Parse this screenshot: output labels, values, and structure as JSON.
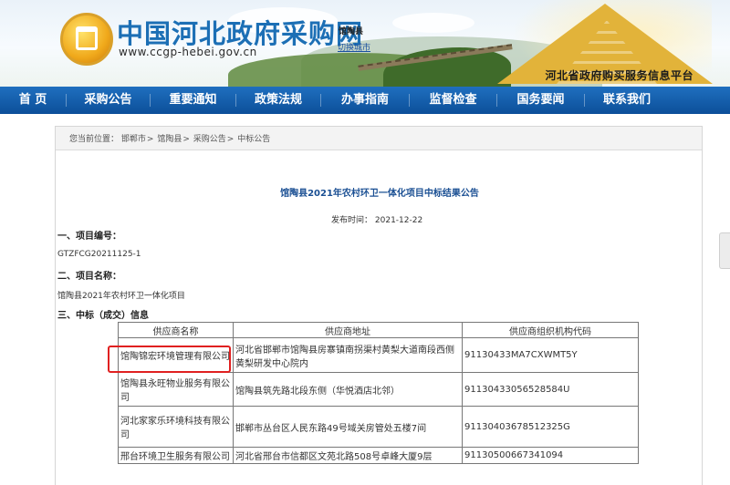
{
  "header": {
    "site_title": "中国河北政府采购网",
    "site_url": "www.ccgp-hebei.gov.cn",
    "city": "馆陶县",
    "switch_city": "切换城市",
    "platform": "河北省政府购买服务信息平台"
  },
  "nav": {
    "items": [
      {
        "label": "首  页"
      },
      {
        "label": "采购公告"
      },
      {
        "label": "重要通知"
      },
      {
        "label": "政策法规"
      },
      {
        "label": "办事指南"
      },
      {
        "label": "监督检查"
      },
      {
        "label": "国务要闻"
      },
      {
        "label": "联系我们"
      }
    ]
  },
  "breadcrumb": {
    "prefix": "您当前位置：",
    "items": [
      "邯郸市",
      "馆陶县",
      "采购公告",
      "中标公告"
    ],
    "separator": ">"
  },
  "notice": {
    "title": "馆陶县2021年农村环卫一体化项目中标结果公告",
    "publish_label": "发布时间：",
    "publish_date": "2021-12-22",
    "section1_title": "一、项目编号：",
    "section1_value": "GTZFCG20211125-1",
    "section2_title": "二、项目名称：",
    "section2_value": "馆陶县2021年农村环卫一体化项目",
    "section3_title": "三、中标（成交）信息"
  },
  "table": {
    "headers": [
      "供应商名称",
      "供应商地址",
      "供应商组织机构代码"
    ],
    "rows": [
      {
        "name": "馆陶锦宏环境管理有限公司",
        "address": "河北省邯郸市馆陶县房寨镇南拐渠村黄梨大道南段西侧黄梨研发中心院内",
        "code": "91130433MA7CXWMT5Y"
      },
      {
        "name": "馆陶县永旺物业服务有限公司",
        "address": "馆陶县筑先路北段东侧（华悦酒店北邻）",
        "code": "91130433056528584U"
      },
      {
        "name": "河北家家乐环境科技有限公司",
        "address": "邯郸市丛台区人民东路49号域关房管处五楼7间",
        "code": "91130403678512325G"
      },
      {
        "name": "邢台环境卫生服务有限公司",
        "address": "河北省邢台市信都区文苑北路508号卓峰大厦9层",
        "code": "91130500667341094"
      }
    ]
  },
  "colors": {
    "nav_bg": "#0c4f99",
    "title_blue": "#1c6fb5",
    "highlight": "#e02020"
  }
}
